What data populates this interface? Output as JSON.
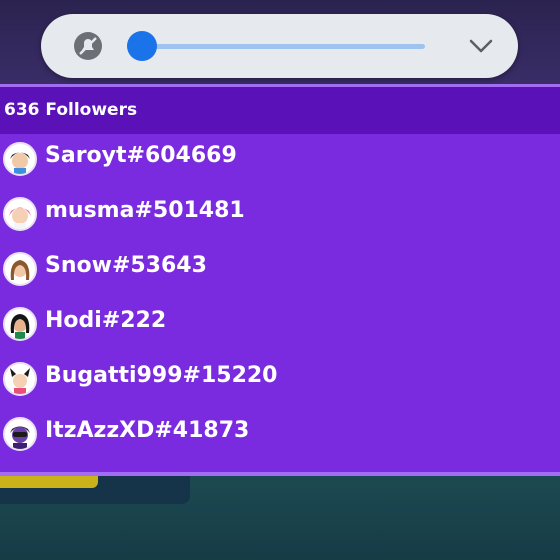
{
  "volume_panel": {
    "level": 0.05,
    "mute_icon": "muted-bell-icon",
    "expand_icon": "chevron-down-icon"
  },
  "followers_panel": {
    "title": "636 Followers",
    "items": [
      {
        "name": "Saroyt#604669",
        "avatar": "avatar-black-hair"
      },
      {
        "name": "musma#501481",
        "avatar": "avatar-pink-hair"
      },
      {
        "name": "Snow#53643",
        "avatar": "avatar-brown-hair"
      },
      {
        "name": "Hodi#222",
        "avatar": "avatar-dark-hair"
      },
      {
        "name": "Bugatti999#15220",
        "avatar": "avatar-cat-ears"
      },
      {
        "name": "ItzAzzXD#41873",
        "avatar": "avatar-purple-mask"
      }
    ]
  },
  "colors": {
    "panel_bg": "#7a2be0",
    "header_bg": "#5a12b8",
    "slider_accent": "#1a73e8"
  }
}
